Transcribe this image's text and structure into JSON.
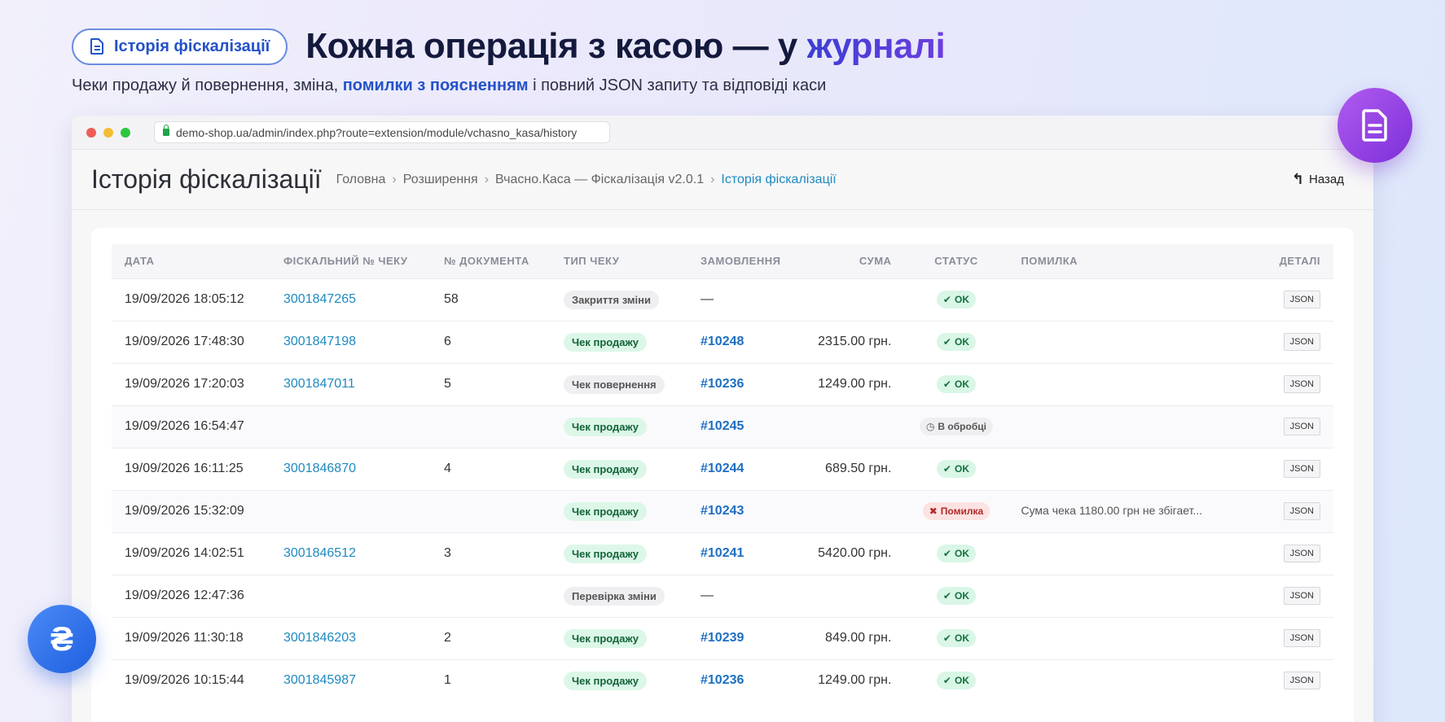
{
  "hero": {
    "badge_label": "Історія фіскалізації",
    "title_main": "Кожна операція з касою — у ",
    "title_accent": "журналі",
    "subtitle_pre": "Чеки продажу й повернення, зміна, ",
    "subtitle_highlight": "помилки з поясненням",
    "subtitle_post": " і повний JSON запиту та відповіді каси"
  },
  "browser": {
    "url": "demo-shop.ua/admin/index.php?route=extension/module/vchasno_kasa/history"
  },
  "page": {
    "title": "Історія фіскалізації",
    "breadcrumbs": [
      "Головна",
      "Розширення",
      "Вчасно.Каса — Фіскалізація v2.0.1",
      "Історія фіскалізації"
    ],
    "back_label": "Назад"
  },
  "table": {
    "headers": [
      "ДАТА",
      "ФІСКАЛЬНИЙ № ЧЕКУ",
      "№ ДОКУМЕНТА",
      "ТИП ЧЕКУ",
      "ЗАМОВЛЕННЯ",
      "СУМА",
      "СТАТУС",
      "ПОМИЛКА",
      "ДЕТАЛІ"
    ],
    "rows": [
      {
        "date": "19/09/2026 18:05:12",
        "fiscal": "3001847265",
        "doc": "58",
        "type": "Закриття зміни",
        "type_kind": "grey",
        "order": "—",
        "sum": "",
        "status": "OK",
        "status_kind": "ok",
        "error": "",
        "details": "JSON"
      },
      {
        "date": "19/09/2026 17:48:30",
        "fiscal": "3001847198",
        "doc": "6",
        "type": "Чек продажу",
        "type_kind": "sale",
        "order": "#10248",
        "sum": "2315.00 грн.",
        "status": "OK",
        "status_kind": "ok",
        "error": "",
        "details": "JSON"
      },
      {
        "date": "19/09/2026 17:20:03",
        "fiscal": "3001847011",
        "doc": "5",
        "type": "Чек повернення",
        "type_kind": "grey",
        "order": "#10236",
        "sum": "1249.00 грн.",
        "status": "OK",
        "status_kind": "ok",
        "error": "",
        "details": "JSON"
      },
      {
        "date": "19/09/2026 16:54:47",
        "fiscal": "",
        "doc": "",
        "type": "Чек продажу",
        "type_kind": "sale",
        "order": "#10245",
        "sum": "",
        "status": "В обробці",
        "status_kind": "proc",
        "error": "",
        "details": "JSON"
      },
      {
        "date": "19/09/2026 16:11:25",
        "fiscal": "3001846870",
        "doc": "4",
        "type": "Чек продажу",
        "type_kind": "sale",
        "order": "#10244",
        "sum": "689.50 грн.",
        "status": "OK",
        "status_kind": "ok",
        "error": "",
        "details": "JSON"
      },
      {
        "date": "19/09/2026 15:32:09",
        "fiscal": "",
        "doc": "",
        "type": "Чек продажу",
        "type_kind": "sale",
        "order": "#10243",
        "sum": "",
        "status": "Помилка",
        "status_kind": "err",
        "error": "Сума чека 1180.00 грн не збігает...",
        "details": "JSON"
      },
      {
        "date": "19/09/2026 14:02:51",
        "fiscal": "3001846512",
        "doc": "3",
        "type": "Чек продажу",
        "type_kind": "sale",
        "order": "#10241",
        "sum": "5420.00 грн.",
        "status": "OK",
        "status_kind": "ok",
        "error": "",
        "details": "JSON"
      },
      {
        "date": "19/09/2026 12:47:36",
        "fiscal": "",
        "doc": "",
        "type": "Перевірка зміни",
        "type_kind": "grey",
        "order": "—",
        "sum": "",
        "status": "OK",
        "status_kind": "ok",
        "error": "",
        "details": "JSON"
      },
      {
        "date": "19/09/2026 11:30:18",
        "fiscal": "3001846203",
        "doc": "2",
        "type": "Чек продажу",
        "type_kind": "sale",
        "order": "#10239",
        "sum": "849.00 грн.",
        "status": "OK",
        "status_kind": "ok",
        "error": "",
        "details": "JSON"
      },
      {
        "date": "19/09/2026 10:15:44",
        "fiscal": "3001845987",
        "doc": "1",
        "type": "Чек продажу",
        "type_kind": "sale",
        "order": "#10236",
        "sum": "1249.00 грн.",
        "status": "OK",
        "status_kind": "ok",
        "error": "",
        "details": "JSON"
      }
    ]
  },
  "fab": {
    "hryvnia_symbol": "₴"
  },
  "colors": {
    "accent": "#2452c8",
    "link": "#1f8ac0",
    "ok_bg": "#d9f6e6",
    "error_bg": "#fde2e2"
  }
}
